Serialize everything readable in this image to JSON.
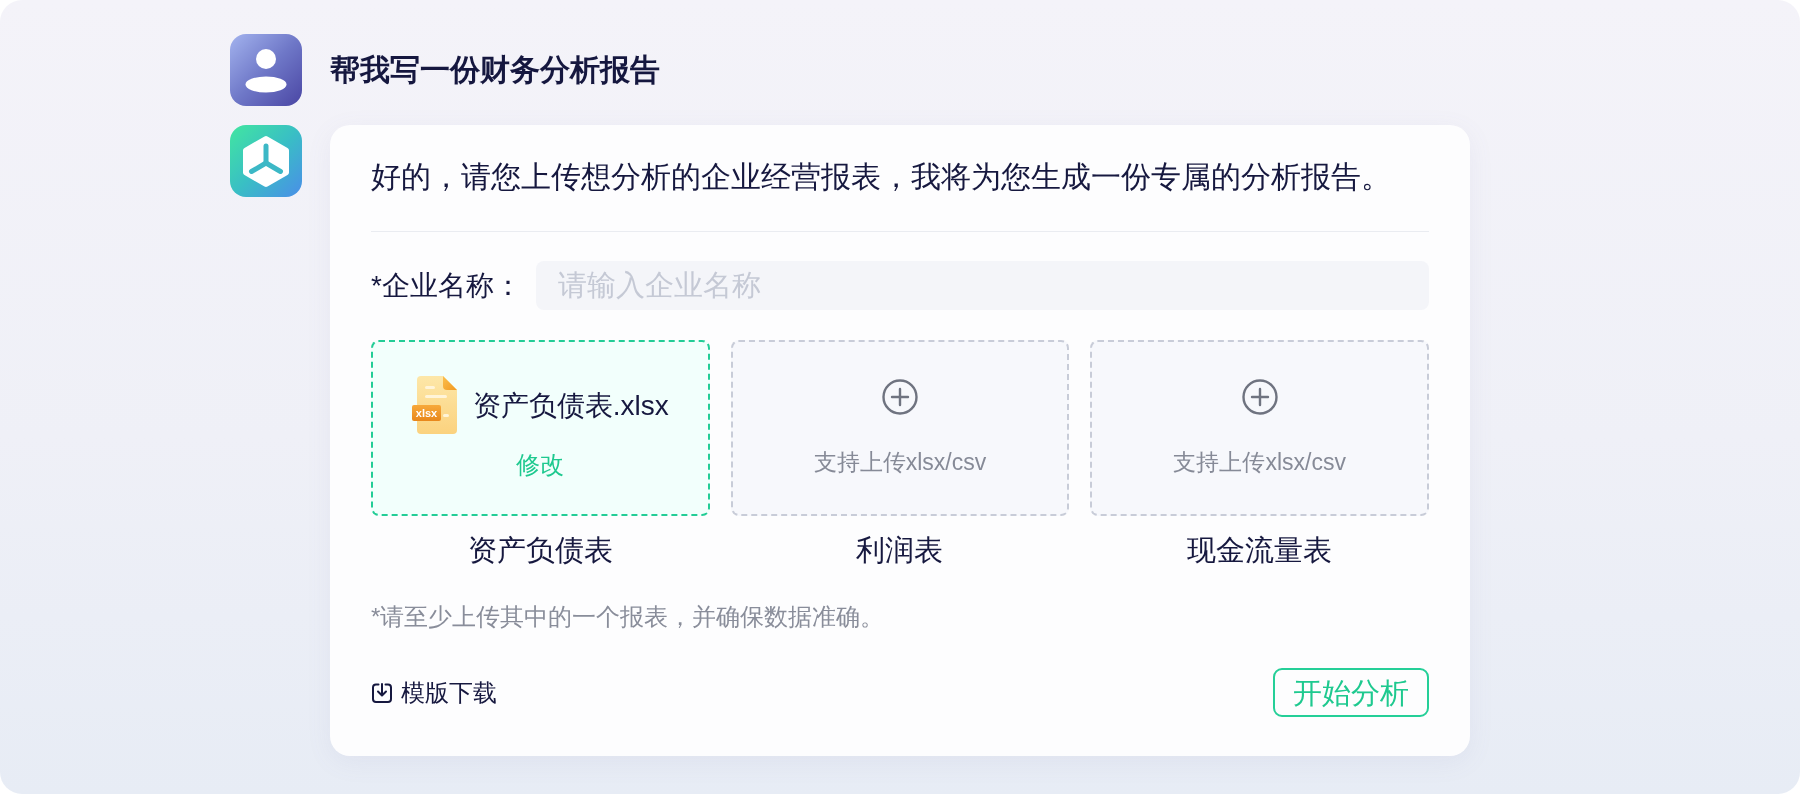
{
  "user_message": {
    "text": "帮我写一份财务分析报告"
  },
  "assistant_message": {
    "text": "好的，请您上传想分析的企业经营报表，我将为您生成一份专属的分析报告。",
    "company_field": {
      "label": "*企业名称：",
      "placeholder": "请输入企业名称"
    },
    "uploads": [
      {
        "kind": "uploaded",
        "label": "资产负债表",
        "file_name": "资产负债表.xlsx",
        "file_type": "xlsx",
        "action": "修改"
      },
      {
        "kind": "empty",
        "label": "利润表",
        "hint": "支持上传xlsx/csv"
      },
      {
        "kind": "empty",
        "label": "现金流量表",
        "hint": "支持上传xlsx/csv"
      }
    ],
    "note": "*请至少上传其中的一个报表，并确保数据准确。",
    "template_link": "模版下载",
    "start_button": "开始分析"
  }
}
